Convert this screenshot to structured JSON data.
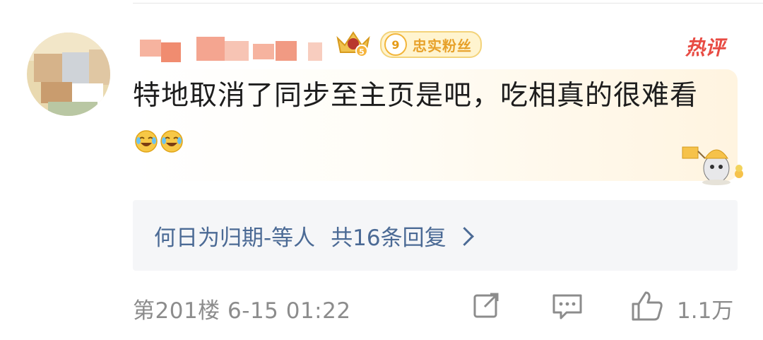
{
  "comment": {
    "hot_tag": "热评",
    "level": "9",
    "level_label": "忠实粉丝",
    "text": "特地取消了同步至主页是吧，吃相真的很难看",
    "emoji": "laugh-cry-emoji"
  },
  "reply": {
    "user": "何日为归期-等人",
    "count_text": "共16条回复"
  },
  "footer": {
    "floor": "第201楼",
    "time": "6-15 01:22",
    "like_count": "1.1万"
  },
  "colors": {
    "link": "#4b6a95",
    "meta": "#8c8c8c",
    "hot": "#e84b43",
    "badge_gold": "#e7a12a"
  },
  "icons": {
    "share": "share-icon",
    "comment": "comment-icon",
    "like": "thumbs-up-icon"
  }
}
